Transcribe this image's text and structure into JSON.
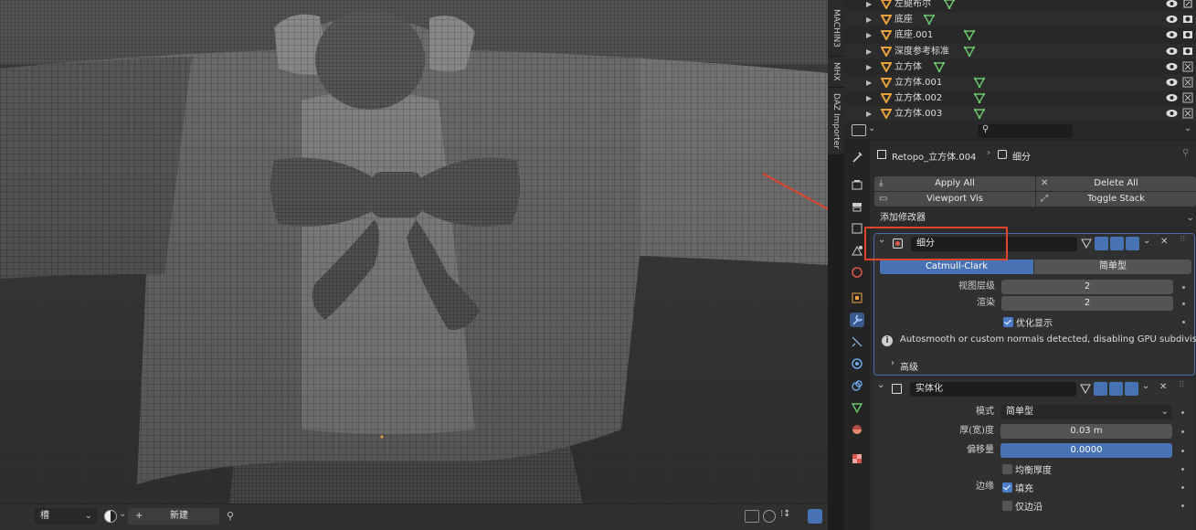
{
  "viewport": {
    "npanel_tabs": [
      "MACHIN3",
      "MHX",
      "DAZ Importer"
    ],
    "footer": {
      "slot_label": "槽",
      "new_label": "新建"
    }
  },
  "outliner": {
    "rows": [
      {
        "name": "左腿布尔",
        "mesh_visible": true,
        "render": "vis"
      },
      {
        "name": "底座",
        "mesh_visible": true,
        "render": "cam"
      },
      {
        "name": "底座.001",
        "mesh_visible": true,
        "render": "cam"
      },
      {
        "name": "深度参考标准",
        "mesh_visible": true,
        "render": "cam"
      },
      {
        "name": "立方体",
        "mesh_visible": true,
        "render": "x"
      },
      {
        "name": "立方体.001",
        "mesh_visible": true,
        "render": "x"
      },
      {
        "name": "立方体.002",
        "mesh_visible": true,
        "render": "x"
      },
      {
        "name": "立方体.003",
        "mesh_visible": true,
        "render": "x"
      }
    ]
  },
  "properties": {
    "search": {
      "placeholder": ""
    },
    "breadcrumb": {
      "object": "Retopo_立方体.004",
      "modifier": "细分"
    },
    "buttons": {
      "apply_all": "Apply All",
      "delete_all": "Delete All",
      "viewport_vis": "Viewport Vis",
      "toggle_stack": "Toggle Stack"
    },
    "add_modifier": "添加修改器",
    "subsurf": {
      "name": "细分",
      "tabs": [
        "Catmull-Clark",
        "简单型"
      ],
      "active_tab": "Catmull-Clark",
      "viewport_label": "视图层级",
      "viewport_value": "2",
      "render_label": "渲染",
      "render_value": "2",
      "optimal_label": "优化显示",
      "optimal_checked": true,
      "warning": "Autosmooth or custom normals detected, disabling GPU subdivisi...",
      "advanced": "高级"
    },
    "solidify": {
      "name": "实体化",
      "mode_label": "模式",
      "mode_value": "简单型",
      "thickness_label": "厚(宽)度",
      "thickness_value": "0.03 m",
      "offset_label": "偏移量",
      "offset_value": "0.0000",
      "even_label": "均衡厚度",
      "even_checked": false,
      "rim_label": "边缘",
      "fill_label": "填充",
      "fill_checked": true,
      "rim_only_label": "仅边沿",
      "rim_only_checked": false
    }
  },
  "colors": {
    "accent": "#4772b3",
    "highlight_box": "#e0452c",
    "object_orange": "#e8a23c",
    "mesh_green": "#6ac46a"
  }
}
